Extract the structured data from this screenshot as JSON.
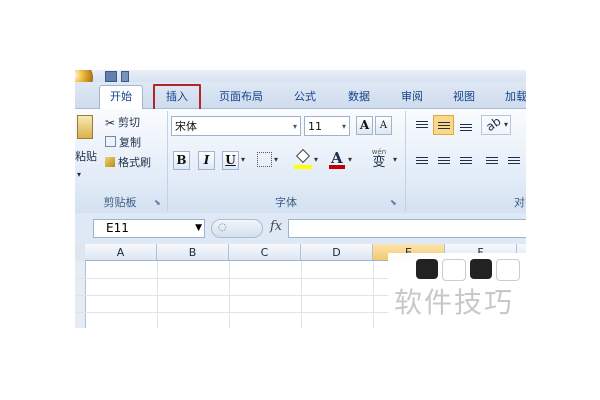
{
  "tabs": [
    {
      "label": "开始",
      "active": true
    },
    {
      "label": "插入",
      "highlighted": true
    },
    {
      "label": "页面布局"
    },
    {
      "label": "公式"
    },
    {
      "label": "数据"
    },
    {
      "label": "审阅"
    },
    {
      "label": "视图"
    },
    {
      "label": "加载"
    }
  ],
  "clipboard": {
    "paste_label": "粘贴",
    "cut_label": "剪切",
    "copy_label": "复制",
    "format_painter_label": "格式刷",
    "group_label": "剪贴板"
  },
  "font": {
    "name": "宋体",
    "size": "11",
    "grow_label": "A",
    "shrink_label": "A",
    "bold_label": "B",
    "italic_label": "I",
    "underline_label": "U",
    "color_label": "A",
    "phonetic_label": "变",
    "group_label": "字体",
    "font_color": "#c00000",
    "fill_color": "#ffff00"
  },
  "alignment": {
    "group_label": "对齐方"
  },
  "formula_bar": {
    "name_box": "E11",
    "fx_label": "fx"
  },
  "columns": [
    "A",
    "B",
    "C",
    "D",
    "E",
    "F"
  ],
  "watermark": {
    "text": "软件技巧"
  },
  "colors": {
    "highlight_border": "#b0262b",
    "tab_text": "#15428b",
    "selected_header": "#f6c96d"
  }
}
